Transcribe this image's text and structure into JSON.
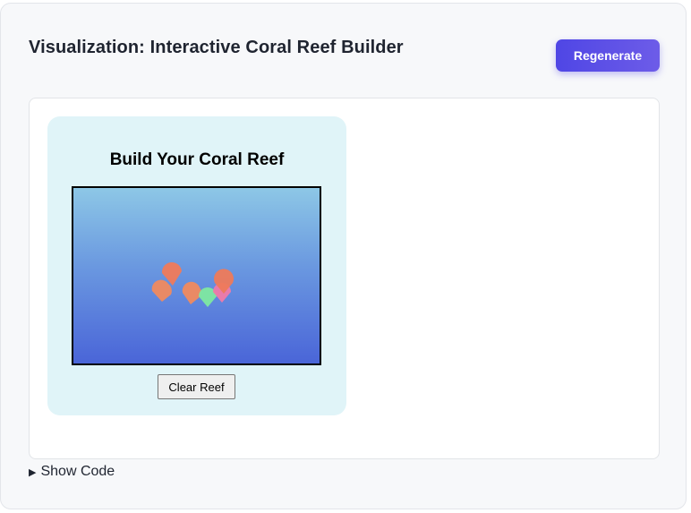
{
  "header": {
    "title": "Visualization: Interactive Coral Reef Builder",
    "regenerate_label": "Regenerate"
  },
  "reef_builder": {
    "heading": "Build Your Coral Reef",
    "clear_label": "Clear Reef",
    "corals": [
      {
        "name": "coral-orange-upper",
        "color": "#f07a5a"
      },
      {
        "name": "coral-orange-left",
        "color": "#f08a5e"
      },
      {
        "name": "coral-orange-middle",
        "color": "#f08a5e"
      },
      {
        "name": "coral-green",
        "color": "#7ee8a0"
      },
      {
        "name": "coral-pink",
        "color": "#f07aa8"
      },
      {
        "name": "coral-orange-right",
        "color": "#ee7a5a"
      }
    ]
  },
  "footer": {
    "show_code_label": "Show Code",
    "disclosure_icon": "triangle-right-icon"
  },
  "colors": {
    "accent": "#4f46e5",
    "card_background": "#e0f4f8",
    "ocean_top": "#8dc7e6",
    "ocean_bottom": "#4a65d8"
  }
}
